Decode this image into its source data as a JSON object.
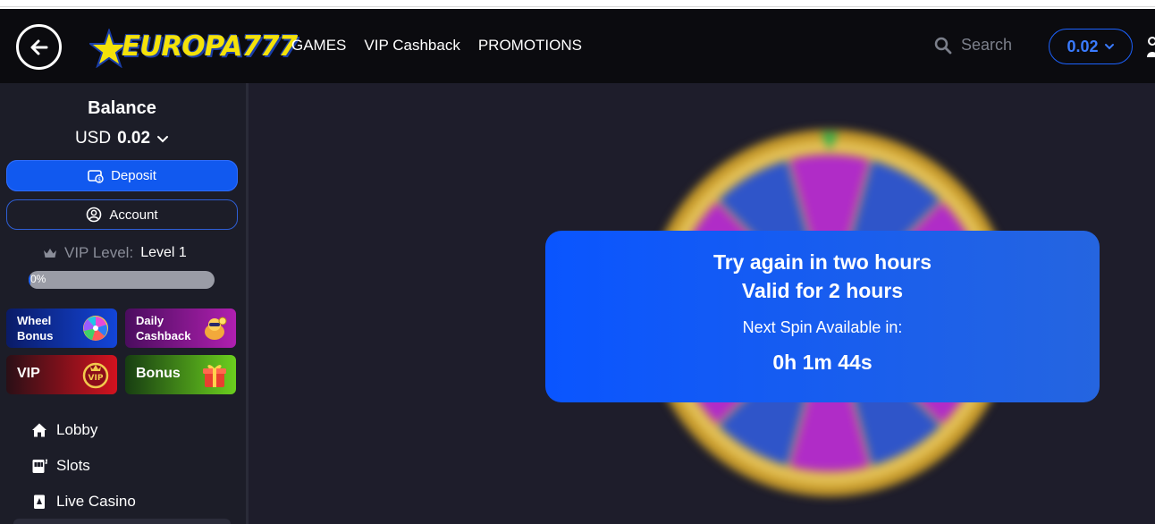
{
  "header": {
    "logo_text": "EUROPA777",
    "nav": [
      "GAMES",
      "VIP Cashback",
      "PROMOTIONS"
    ],
    "search_placeholder": "Search",
    "balance_pill": "0.02"
  },
  "sidebar": {
    "balance_title": "Balance",
    "currency": "USD",
    "amount": "0.02",
    "deposit_label": "Deposit",
    "account_label": "Account",
    "vip_label": "VIP Level:",
    "vip_level": "Level 1",
    "progress_text": "0%",
    "progress_value": 0.01,
    "promos": {
      "wheel": [
        "Wheel",
        "Bonus"
      ],
      "daily": [
        "Daily",
        "Cashback"
      ],
      "vip": "VIP",
      "bonus": "Bonus"
    },
    "menu": [
      "Lobby",
      "Slots",
      "Live Casino"
    ]
  },
  "modal": {
    "line1": "Try again in two hours",
    "line2": "Valid for 2 hours",
    "next_label": "Next Spin Available in:",
    "countdown": "0h 1m 44s"
  },
  "colors": {
    "accent": "#1159ef",
    "header_bg": "#0b0b0f",
    "sidebar_bg": "#1c1d28",
    "main_bg": "#1e1d2b",
    "logo_yellow": "#f4e20a"
  },
  "icons": {
    "back": "arrow-left-icon",
    "search": "search-icon",
    "chevron": "chevron-down-icon",
    "deposit": "wallet-icon",
    "account": "user-circle-icon",
    "crown": "crown-icon",
    "lobby": "home-icon",
    "slots": "slot-machine-icon",
    "live": "playing-card-icon"
  }
}
